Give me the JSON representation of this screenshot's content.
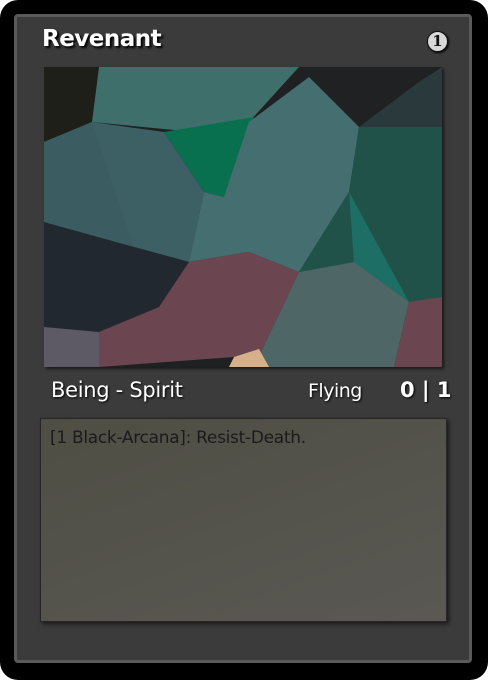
{
  "card": {
    "name": "Revenant",
    "cost": "1",
    "type_line": "Being - Spirit",
    "keyword": "Flying",
    "power_toughness": "0 | 1",
    "rules_text": "[1 Black-Arcana]: Resist-Death.",
    "cost_icon": "numbered-circle-icon"
  },
  "colors": {
    "frame": "#3b3b3b",
    "border": "#000000",
    "text_box": "#55544d",
    "cost_badge": "#d8d8d8"
  }
}
